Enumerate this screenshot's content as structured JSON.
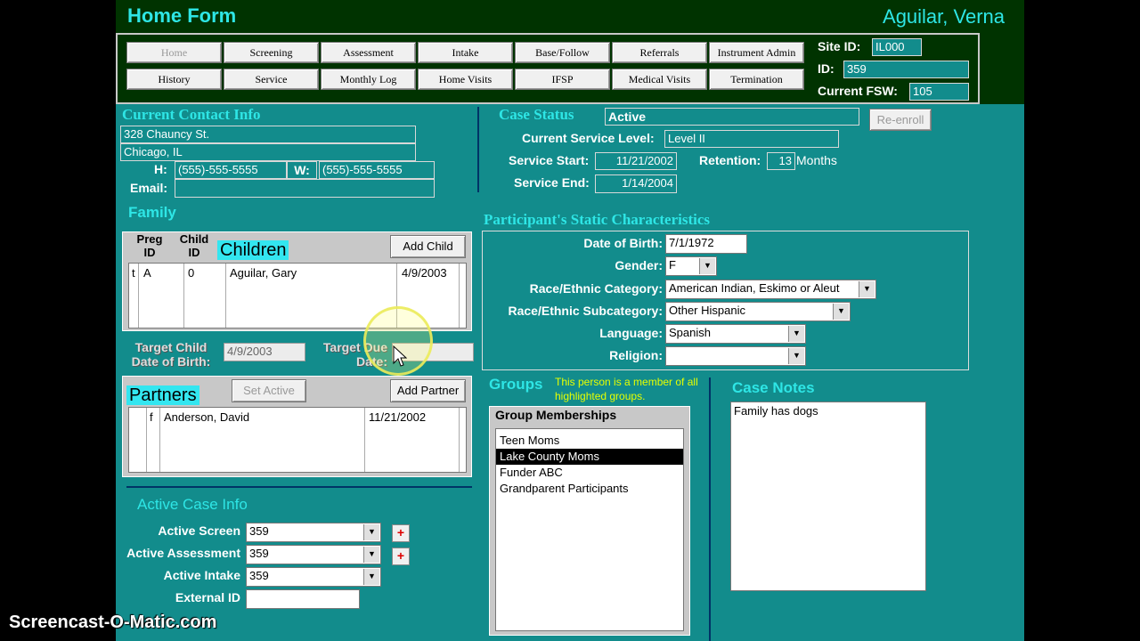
{
  "window": {
    "title": "Home Form",
    "client_name": "Aguilar, Verna"
  },
  "nav": {
    "row1": [
      "Home",
      "Screening",
      "Assessment",
      "Intake",
      "Base/Follow",
      "Referrals",
      "Instrument Admin"
    ],
    "row2": [
      "History",
      "Service",
      "Monthly Log",
      "Home Visits",
      "IFSP",
      "Medical Visits",
      "Termination"
    ]
  },
  "site": {
    "site_id_label": "Site ID:",
    "site_id": "IL000",
    "id_label": "ID:",
    "id": "359",
    "fsw_label": "Current FSW:",
    "fsw": "105"
  },
  "contact": {
    "title": "Current Contact Info",
    "address1": "328 Chauncy St.",
    "address2": "Chicago, IL",
    "home_label": "H:",
    "home_phone": "(555)-555-5555",
    "work_label": "W:",
    "work_phone": "(555)-555-5555",
    "email_label": "Email:",
    "email": ""
  },
  "case_status": {
    "title": "Case Status",
    "status": "Active",
    "reenroll_label": "Re-enroll",
    "service_level_label": "Current Service Level:",
    "service_level": "Level II",
    "service_start_label": "Service Start:",
    "service_start": "11/21/2002",
    "retention_label": "Retention:",
    "retention": "13",
    "retention_unit": "Months",
    "service_end_label": "Service End:",
    "service_end": "1/14/2004"
  },
  "family": {
    "title": "Family",
    "preg_id_header": "Preg ID",
    "child_id_header": "Child ID",
    "children_title": "Children",
    "add_child_label": "Add Child",
    "children": [
      {
        "flag": "t",
        "preg_id": "A",
        "child_id": "0",
        "name": "Aguilar, Gary",
        "dob": "4/9/2003"
      }
    ],
    "target_child_dob_label": "Target Child Date of Birth:",
    "target_child_dob": "4/9/2003",
    "target_due_date_label": "Target Due Date:",
    "target_due_date": ""
  },
  "partners": {
    "title": "Partners",
    "set_active_label": "Set Active",
    "add_partner_label": "Add Partner",
    "list": [
      {
        "flag": "f",
        "name": "Anderson, David",
        "date": "11/21/2002"
      }
    ]
  },
  "active_case": {
    "title": "Active Case Info",
    "screen_label": "Active Screen",
    "screen": "359",
    "assessment_label": "Active Assessment",
    "assessment": "359",
    "intake_label": "Active Intake",
    "intake": "359",
    "external_id_label": "External ID",
    "external_id": ""
  },
  "static": {
    "title": "Participant's Static Characteristics",
    "dob_label": "Date of Birth:",
    "dob": "7/1/1972",
    "gender_label": "Gender:",
    "gender": "F",
    "race_label": "Race/Ethnic Category:",
    "race": "American Indian, Eskimo or Aleut",
    "subcat_label": "Race/Ethnic Subcategory:",
    "subcat": "Other Hispanic",
    "language_label": "Language:",
    "language": "Spanish",
    "religion_label": "Religion:",
    "religion": ""
  },
  "groups": {
    "title": "Groups",
    "note": "This person is a member of all highlighted groups.",
    "memberships_title": "Group Memberships",
    "items": [
      "Teen Moms",
      "Lake County Moms",
      "Funder ABC",
      "Grandparent Participants"
    ]
  },
  "notes": {
    "title": "Case Notes",
    "text": "Family has dogs"
  },
  "watermark": "Screencast-O-Matic.com",
  "colors": {
    "form_bg": "#128c8c",
    "title_bar": "#003300",
    "accent": "#2ee6e6",
    "selected_bg": "#000000"
  }
}
